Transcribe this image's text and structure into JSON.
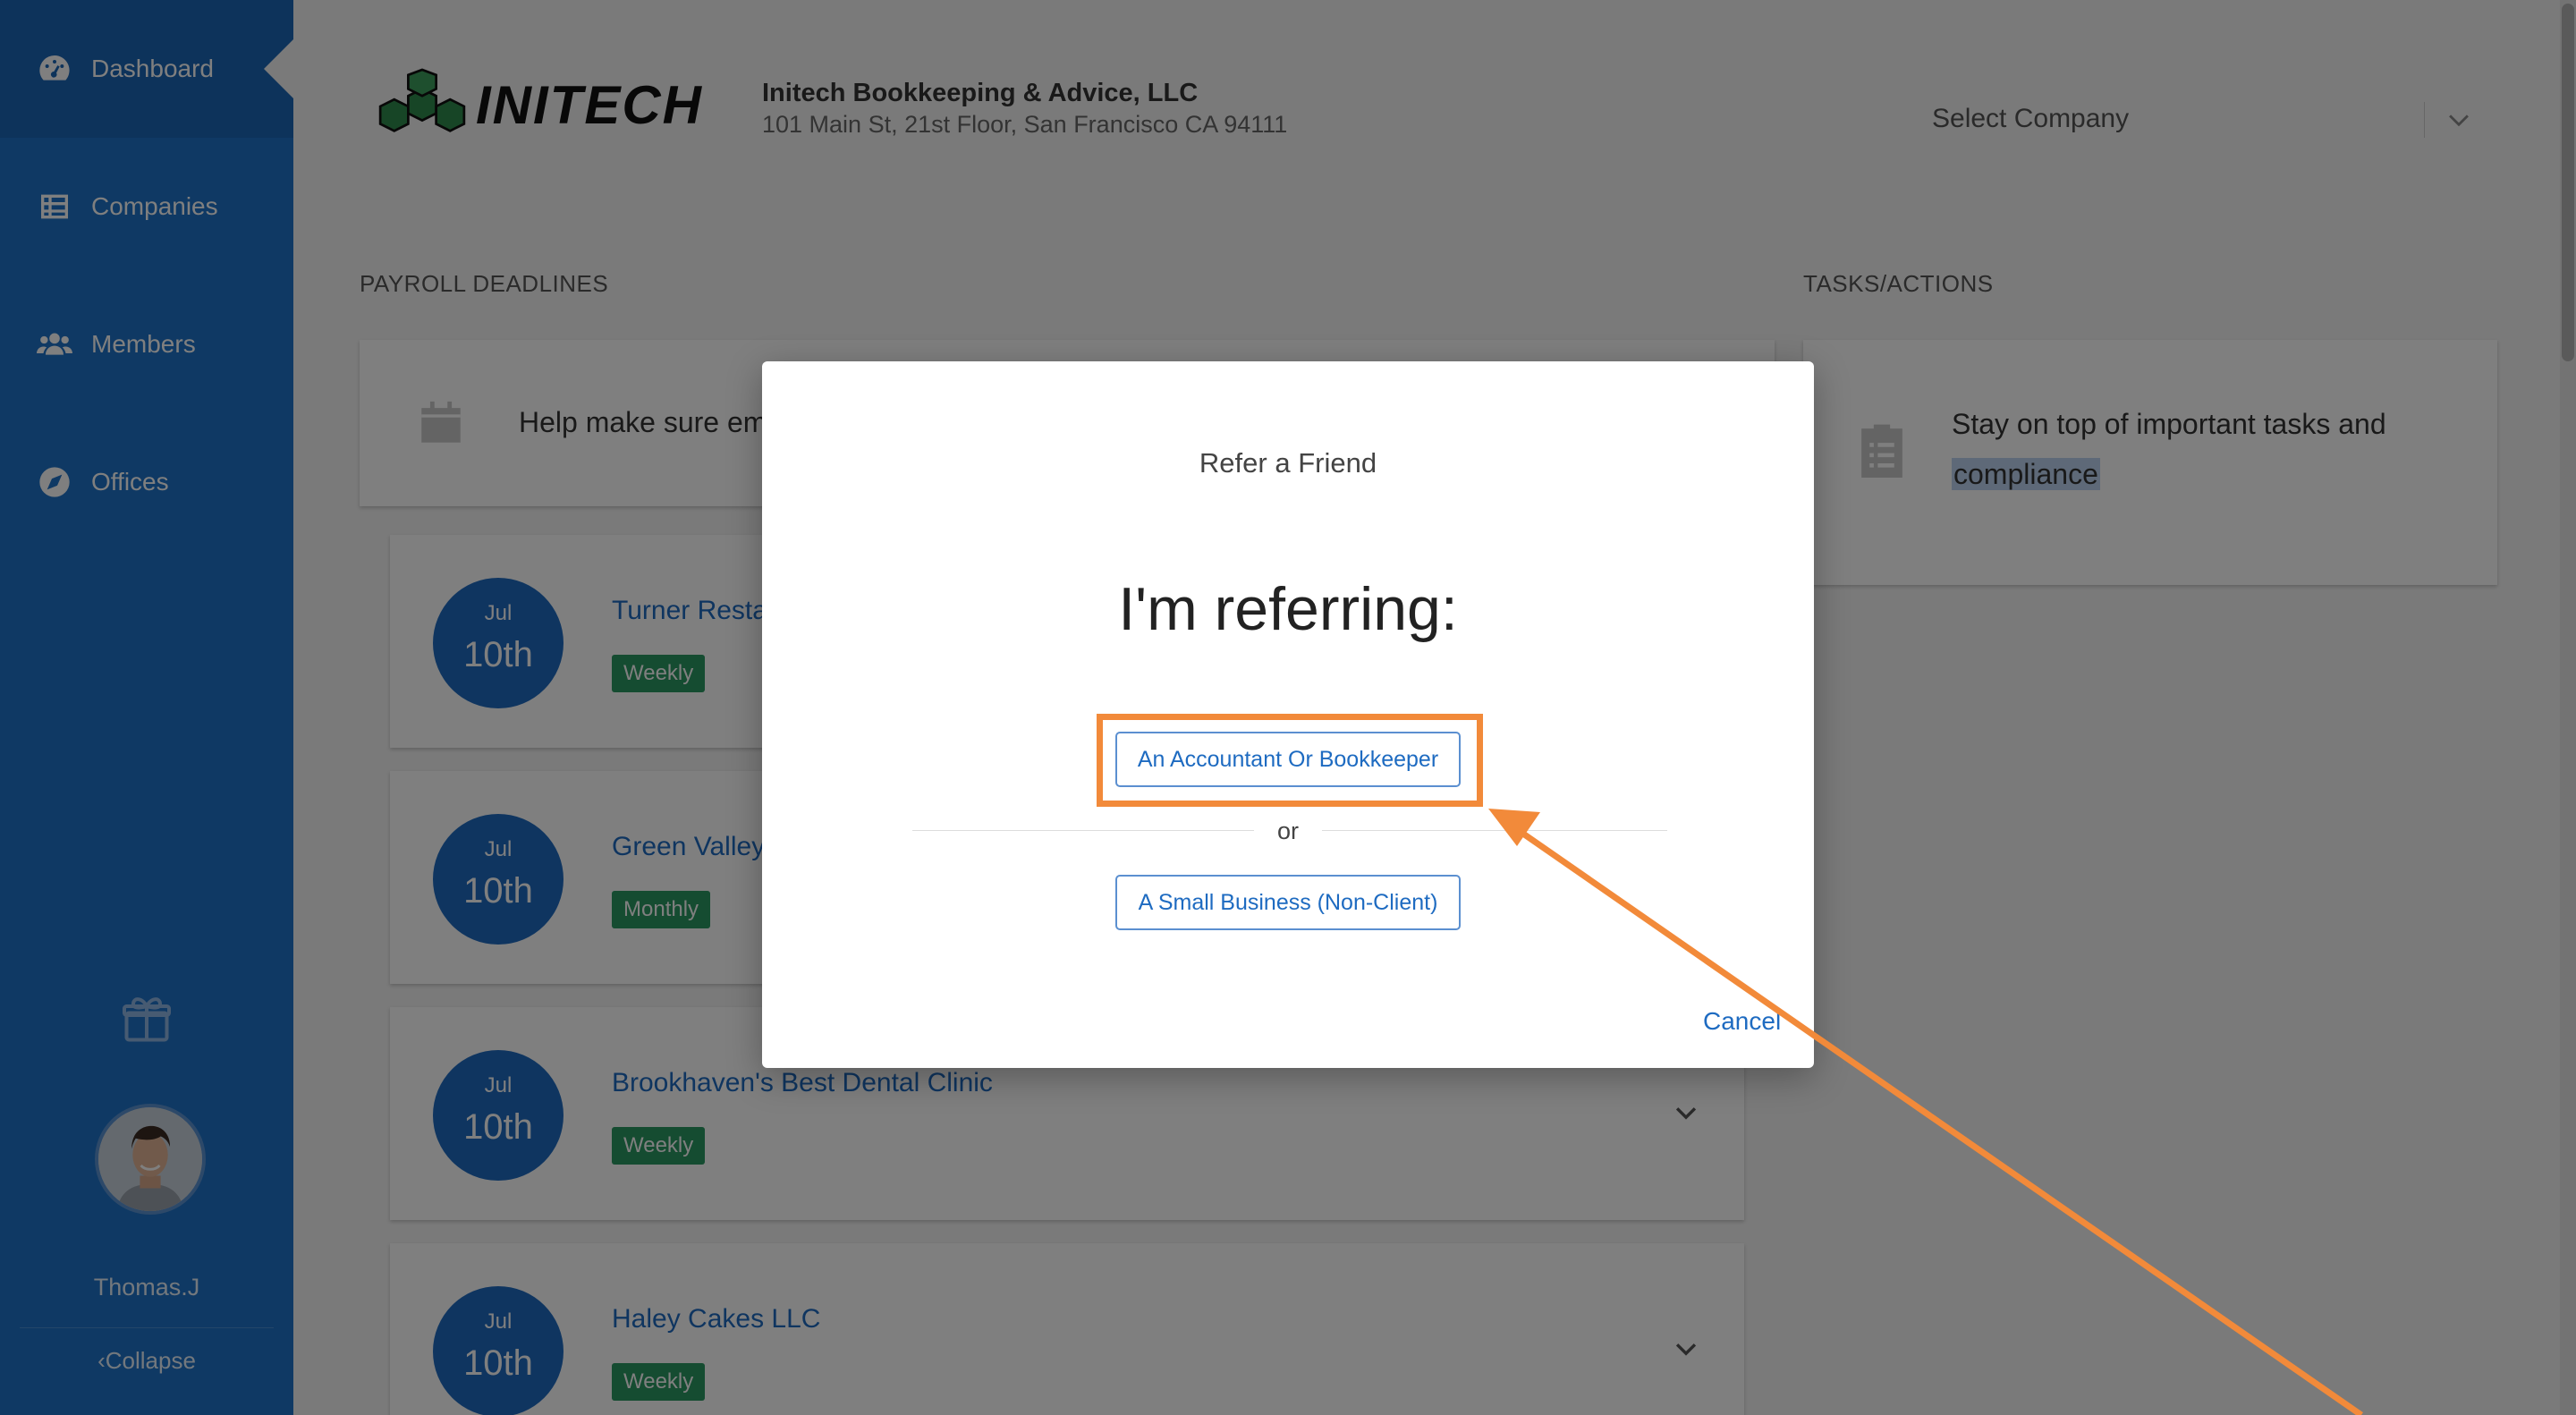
{
  "sidebar": {
    "items": [
      {
        "label": "Dashboard",
        "icon": "dashboard-icon",
        "active": true
      },
      {
        "label": "Companies",
        "icon": "list-icon"
      },
      {
        "label": "Members",
        "icon": "users-icon"
      },
      {
        "label": "Offices",
        "icon": "compass-icon"
      }
    ],
    "username": "Thomas.J",
    "collapse_label": "Collapse"
  },
  "header": {
    "logo_text": "INITECH",
    "company_name": "Initech Bookkeeping & Advice, LLC",
    "company_address": "101 Main St, 21st Floor, San Francisco CA 94111",
    "select_company": "Select Company"
  },
  "payroll": {
    "label": "PAYROLL DEADLINES",
    "info_text": "Help make sure em",
    "rows": [
      {
        "month": "Jul",
        "day": "10th",
        "name": "Turner Resta",
        "frequency": "Weekly"
      },
      {
        "month": "Jul",
        "day": "10th",
        "name": "Green Valley",
        "frequency": "Monthly"
      },
      {
        "month": "Jul",
        "day": "10th",
        "name": "Brookhaven's Best Dental Clinic",
        "frequency": "Weekly"
      },
      {
        "month": "Jul",
        "day": "10th",
        "name": "Haley Cakes LLC",
        "frequency": "Weekly"
      }
    ]
  },
  "tasks": {
    "label": "TASKS/ACTIONS",
    "text_line1": "Stay on top of important tasks and",
    "text_highlight": "compliance"
  },
  "modal": {
    "title": "Refer a Friend",
    "heading": "I'm referring:",
    "option_accountant": "An Accountant Or Bookkeeper",
    "or_text": "or",
    "option_business": "A Small Business (Non-Client)",
    "cancel": "Cancel"
  },
  "colors": {
    "sidebar": "#1e73c8",
    "accent": "#1e6bc1",
    "badge": "#2a9862",
    "annotation": "#f28a3a"
  }
}
